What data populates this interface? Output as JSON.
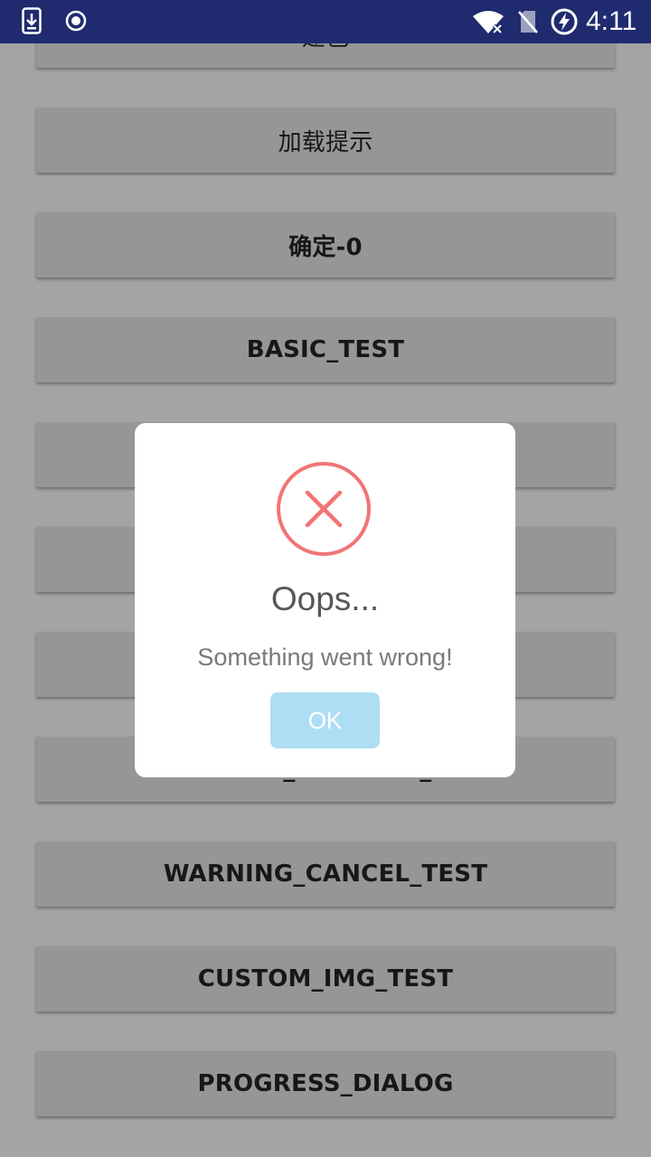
{
  "status_bar": {
    "time": "4:11",
    "icons": [
      "download-notification-icon",
      "record-notification-icon",
      "wifi-no-internet-icon",
      "no-sim-icon",
      "battery-charging-icon"
    ]
  },
  "list": {
    "buttons": [
      {
        "label": "建色"
      },
      {
        "label": "加载提示"
      },
      {
        "label": "确定-0"
      },
      {
        "label": "BASIC_TEST"
      },
      {
        "label": ""
      },
      {
        "label": ""
      },
      {
        "label": ""
      },
      {
        "label": "WARNING_CONFIRM_TEST"
      },
      {
        "label": "WARNING_CANCEL_TEST"
      },
      {
        "label": "CUSTOM_IMG_TEST"
      },
      {
        "label": "PROGRESS_DIALOG"
      }
    ]
  },
  "dialog": {
    "icon": "error-x-icon",
    "title": "Oops...",
    "message": "Something went wrong!",
    "ok_label": "OK",
    "accent_color": "#f27474",
    "ok_color": "#aedef4"
  }
}
